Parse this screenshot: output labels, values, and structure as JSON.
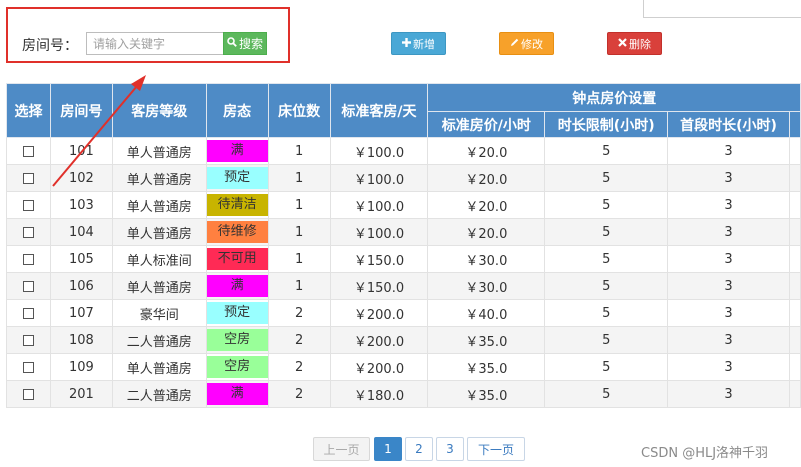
{
  "search": {
    "label": "房间号：",
    "placeholder": "请输入关键字",
    "button_label": "搜索",
    "button_icon": "search-icon"
  },
  "toolbar": {
    "add_label": "新增",
    "add_icon": "plus-icon",
    "edit_label": "修改",
    "edit_icon": "pencil-icon",
    "delete_label": "删除",
    "delete_icon": "times-icon"
  },
  "table": {
    "headers": {
      "select": "选择",
      "room_no": "房间号",
      "level": "客房等级",
      "status": "房态",
      "beds": "床位数",
      "std_price": "标准客房/天",
      "hourly_group": "钟点房价设置",
      "hourly_price": "标准房价/小时",
      "time_limit": "时长限制(小时)",
      "first_period": "首段时长(小时)"
    },
    "rows": [
      {
        "room": "101",
        "level": "单人普通房",
        "status": "满",
        "beds": "1",
        "price": "￥100.0",
        "hourly": "￥20.0",
        "limit": "5",
        "first": "3"
      },
      {
        "room": "102",
        "level": "单人普通房",
        "status": "预定",
        "beds": "1",
        "price": "￥100.0",
        "hourly": "￥20.0",
        "limit": "5",
        "first": "3"
      },
      {
        "room": "103",
        "level": "单人普通房",
        "status": "待清洁",
        "beds": "1",
        "price": "￥100.0",
        "hourly": "￥20.0",
        "limit": "5",
        "first": "3"
      },
      {
        "room": "104",
        "level": "单人普通房",
        "status": "待维修",
        "beds": "1",
        "price": "￥100.0",
        "hourly": "￥20.0",
        "limit": "5",
        "first": "3"
      },
      {
        "room": "105",
        "level": "单人标准间",
        "status": "不可用",
        "beds": "1",
        "price": "￥150.0",
        "hourly": "￥30.0",
        "limit": "5",
        "first": "3"
      },
      {
        "room": "106",
        "level": "单人普通房",
        "status": "满",
        "beds": "1",
        "price": "￥150.0",
        "hourly": "￥30.0",
        "limit": "5",
        "first": "3"
      },
      {
        "room": "107",
        "level": "豪华间",
        "status": "预定",
        "beds": "2",
        "price": "￥200.0",
        "hourly": "￥40.0",
        "limit": "5",
        "first": "3"
      },
      {
        "room": "108",
        "level": "二人普通房",
        "status": "空房",
        "beds": "2",
        "price": "￥200.0",
        "hourly": "￥35.0",
        "limit": "5",
        "first": "3"
      },
      {
        "room": "109",
        "level": "单人普通房",
        "status": "空房",
        "beds": "2",
        "price": "￥200.0",
        "hourly": "￥35.0",
        "limit": "5",
        "first": "3"
      },
      {
        "room": "201",
        "level": "二人普通房",
        "status": "满",
        "beds": "2",
        "price": "￥180.0",
        "hourly": "￥35.0",
        "limit": "5",
        "first": "3"
      }
    ],
    "status_colors": {
      "满": "#ff00ff",
      "预定": "#99ffff",
      "待清洁": "#c8b400",
      "待维修": "#ff8040",
      "不可用": "#ff2a55",
      "空房": "#99ff99"
    }
  },
  "pagination": {
    "prev": "上一页",
    "pages": [
      "1",
      "2",
      "3"
    ],
    "current_page": "1",
    "next": "下一页"
  },
  "watermark": "CSDN @HLJ洛神千羽",
  "colors": {
    "header_bg": "#4e8bc6",
    "highlight_border": "#e0302a",
    "search_button": "#5cb85c",
    "add_button": "#4aa8d6",
    "edit_button": "#f7a12a",
    "delete_button": "#d9403b",
    "arrow": "#e0302a"
  }
}
